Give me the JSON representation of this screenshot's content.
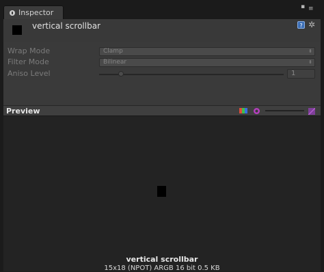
{
  "tab": {
    "title": "Inspector",
    "icon": "info-icon"
  },
  "window_controls": {
    "icons": [
      "lock-icon",
      "menu-icon"
    ]
  },
  "header": {
    "asset_name": "vertical scrollbar",
    "icons": [
      "texture-thumbnail",
      "help-icon",
      "gear-icon"
    ],
    "help_glyph": "?",
    "gear_glyph": "✲"
  },
  "properties": {
    "wrap_mode": {
      "label": "Wrap Mode",
      "value": "Clamp"
    },
    "filter_mode": {
      "label": "Filter Mode",
      "value": "Bilinear"
    },
    "aniso_level": {
      "label": "Aniso Level",
      "value": "1",
      "level_fraction": 0.12
    }
  },
  "preview": {
    "title": "Preview",
    "toolbar_icons": [
      "rgb-channel-icon",
      "mip-level-icon",
      "mip-slider",
      "alpha-toggle-icon"
    ],
    "texture_name": "vertical scrollbar",
    "texture_info": "15x18 (NPOT)  ARGB 16 bit  0.5 KB",
    "colors": {
      "rgb": [
        "#e04b3b",
        "#3fbf4a",
        "#3a6fe0"
      ]
    }
  },
  "colors": {
    "background": "#1e1e1e",
    "panel": "#3a3a3a",
    "preview_bg": "#232323",
    "label": "#7b7b7b",
    "title": "#e2e2e2"
  }
}
